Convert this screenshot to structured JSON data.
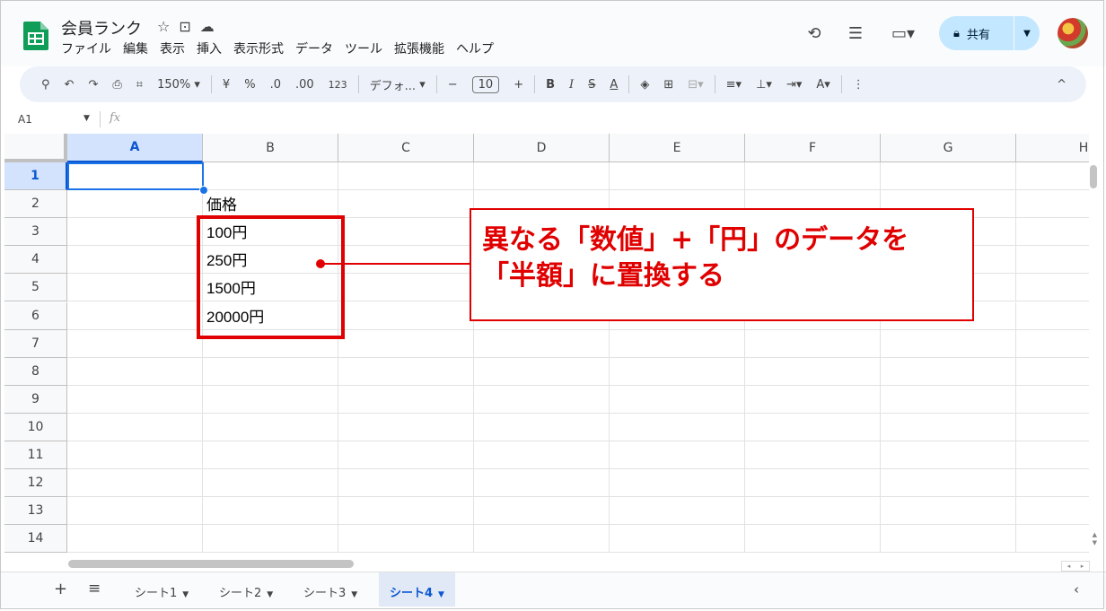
{
  "doc": {
    "title": "会員ランク",
    "title_icons": [
      "star-icon",
      "move-to-folder-icon",
      "cloud-status-icon"
    ]
  },
  "menu": [
    "ファイル",
    "編集",
    "表示",
    "挿入",
    "表示形式",
    "データ",
    "ツール",
    "拡張機能",
    "ヘルプ"
  ],
  "header_right": {
    "share_label": "共有",
    "icons": [
      "version-history-icon",
      "comments-icon",
      "meet-icon",
      "lock-icon",
      "avatar"
    ]
  },
  "toolbar": {
    "zoom": "150%",
    "currency": "¥",
    "percent": "%",
    "dec_decrease": ".0",
    "dec_increase": ".00",
    "number_format": "123",
    "font": "デフォ...",
    "font_size": "10",
    "minus": "−",
    "plus": "+",
    "bold": "B",
    "italic": "I",
    "strike": "S",
    "text_color": "A",
    "borders": "⊞",
    "collapse": "^"
  },
  "formula_bar": {
    "name_box": "A1",
    "fx": "fx"
  },
  "columns": [
    "A",
    "B",
    "C",
    "D",
    "E",
    "F",
    "G",
    "H"
  ],
  "rows": [
    "1",
    "2",
    "3",
    "4",
    "5",
    "6",
    "7",
    "8",
    "9",
    "10",
    "11",
    "12",
    "13",
    "14"
  ],
  "cells": {
    "B2": "価格",
    "B3": "100円",
    "B4": "250円",
    "B5": "1500円",
    "B6": "20000円"
  },
  "selected_cell": "A1",
  "sheets": [
    {
      "name": "シート1",
      "active": false
    },
    {
      "name": "シート2",
      "active": false
    },
    {
      "name": "シート3",
      "active": false
    },
    {
      "name": "シート4",
      "active": true
    }
  ],
  "annotation": {
    "line1": "異なる「数値」+「円」のデータを",
    "line2": "「半額」に置換する",
    "color": "#e00000"
  },
  "colors": {
    "accent": "#0b57d0",
    "share_bg": "#c2e7ff",
    "logo_green": "#0f9d58"
  }
}
